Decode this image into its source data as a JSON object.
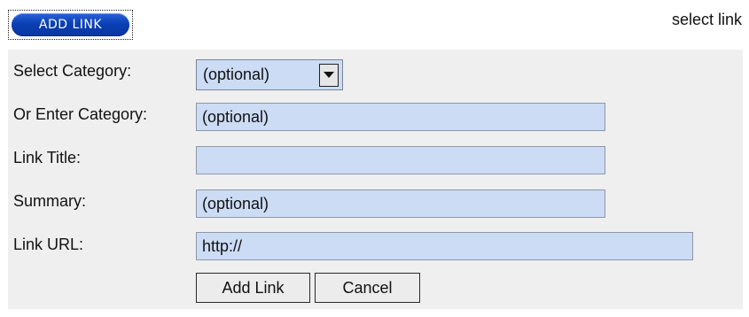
{
  "header": {
    "add_link_button": "ADD LINK",
    "select_link": "select link"
  },
  "form": {
    "category_select": {
      "label": "Select Category:",
      "value": "(optional)"
    },
    "enter_category": {
      "label": "Or Enter Category:",
      "value": "(optional)"
    },
    "link_title": {
      "label": "Link Title:",
      "value": ""
    },
    "summary": {
      "label": "Summary:",
      "value": "(optional)"
    },
    "link_url": {
      "label": "Link URL:",
      "value": "http://"
    },
    "buttons": {
      "submit": "Add Link",
      "cancel": "Cancel"
    }
  },
  "colors": {
    "field_background": "#ccdcf5",
    "panel_background": "#efefef",
    "primary_button": "#0a3fb5"
  },
  "icons": {
    "select_arrow": "chevron-down-icon"
  }
}
